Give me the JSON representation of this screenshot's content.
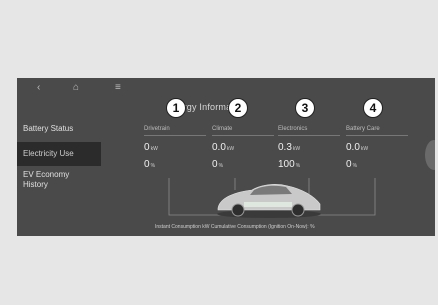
{
  "topbar": {
    "back_icon": "back-icon",
    "home_icon": "home-icon",
    "menu_icon": "menu-icon"
  },
  "sidebar": {
    "items": [
      {
        "label": "Battery Status"
      },
      {
        "label": "Electricity Use"
      },
      {
        "label": "EV Economy History"
      }
    ]
  },
  "main": {
    "title": "Energy Information",
    "callouts": [
      "1",
      "2",
      "3",
      "4"
    ],
    "cards": [
      {
        "label": "Drivetrain",
        "energy": "0",
        "energy_unit": "kW",
        "percent": "0",
        "percent_unit": "%"
      },
      {
        "label": "Climate",
        "energy": "0.0",
        "energy_unit": "kW",
        "percent": "0",
        "percent_unit": "%"
      },
      {
        "label": "Electronics",
        "energy": "0.3",
        "energy_unit": "kW",
        "percent": "100",
        "percent_unit": "%"
      },
      {
        "label": "Battery Care",
        "energy": "0.0",
        "energy_unit": "kW",
        "percent": "0",
        "percent_unit": "%"
      }
    ],
    "footer": "Instant Consumption kW    Cumulative Consumption (Ignition On-Now): %"
  }
}
